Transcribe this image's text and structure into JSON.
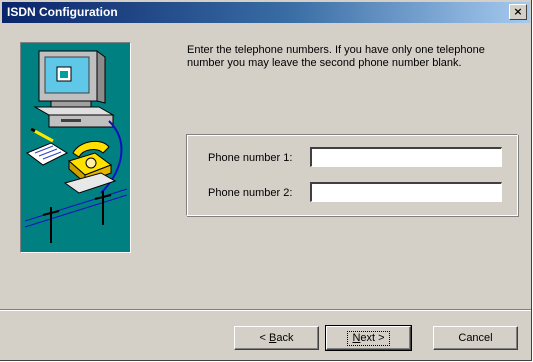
{
  "window": {
    "title": "ISDN Configuration",
    "close_label": "×"
  },
  "instructions": "Enter the telephone numbers.  If you have only one telephone number you may leave the second phone number blank.",
  "fields": {
    "phone1": {
      "label": "Phone number 1:",
      "value": ""
    },
    "phone2": {
      "label": "Phone number 2:",
      "value": ""
    }
  },
  "buttons": {
    "back": {
      "mnemonic": "B",
      "rest": "ack"
    },
    "next": {
      "mnemonic": "N",
      "rest": "ext >"
    },
    "cancel": "Cancel"
  },
  "icons": {
    "art": "isdn-computer-telephone-illustration",
    "close": "close-icon"
  },
  "colors": {
    "titlebar_start": "#0a246a",
    "titlebar_end": "#a6caf0",
    "dialog_bg": "#d4d0c8",
    "art_bg": "#008080"
  }
}
